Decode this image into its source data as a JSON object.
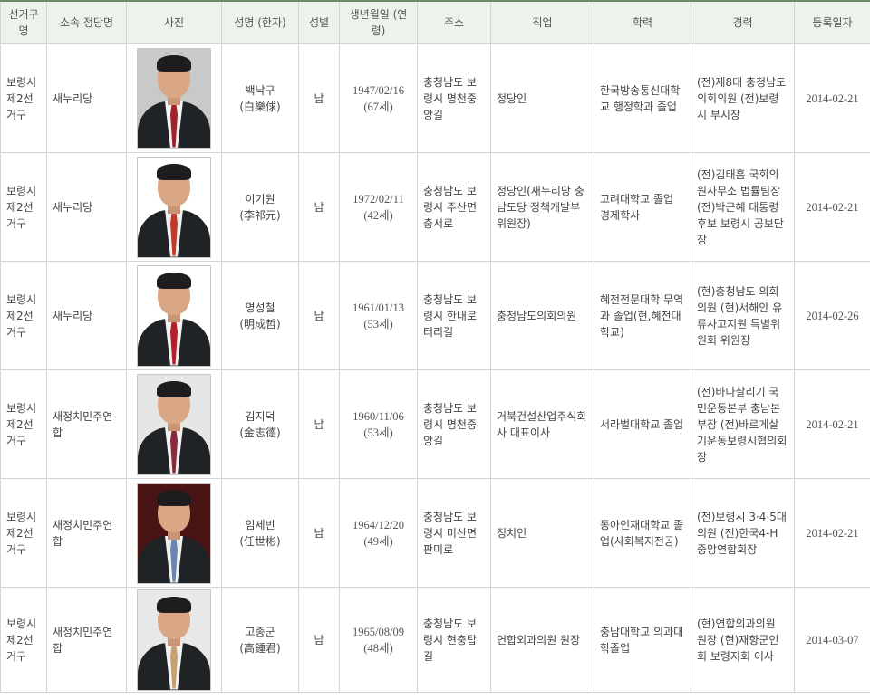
{
  "headers": {
    "district": "선거구명",
    "party": "소속 정당명",
    "photo": "사진",
    "name": "성명 (한자)",
    "sex": "성별",
    "birth": "생년월일 (연령)",
    "address": "주소",
    "job": "직업",
    "edu": "학력",
    "career": "경력",
    "reg": "등록일자"
  },
  "rows": [
    {
      "district": "보령시 제2선거구",
      "party": "새누리당",
      "name": "백낙구",
      "hanja": "(白樂俅)",
      "sex": "남",
      "birth": "1947/02/16",
      "age": "(67세)",
      "address": "충청남도 보령시 명천중앙길",
      "job": "정당인",
      "edu": "한국방송통신대학교 행정학과 졸업",
      "career": "(전)제8대 충청남도의회의원 (전)보령시 부시장",
      "reg": "2014-02-21",
      "photo": {
        "bg": "#c9c9c9",
        "tie": "#a3222a"
      }
    },
    {
      "district": "보령시 제2선거구",
      "party": "새누리당",
      "name": "이기원",
      "hanja": "(李祁元)",
      "sex": "남",
      "birth": "1972/02/11",
      "age": "(42세)",
      "address": "충청남도 보령시 주산면 충서로",
      "job": "정당인(새누리당 충남도당 정책개발부위원장)",
      "edu": "고려대학교 졸업 경제학사",
      "career": "(전)김태흠 국회의원사무소 법률팀장 (전)박근혜 대통령후보 보령시 공보단장",
      "reg": "2014-02-21",
      "photo": {
        "bg": "#ffffff",
        "tie": "#c0392b"
      }
    },
    {
      "district": "보령시 제2선거구",
      "party": "새누리당",
      "name": "명성철",
      "hanja": "(明成哲)",
      "sex": "남",
      "birth": "1961/01/13",
      "age": "(53세)",
      "address": "충청남도 보령시 한내로터리길",
      "job": "충청남도의회의원",
      "edu": "혜전전문대학 무역과 졸업(현,혜전대학교)",
      "career": "(현)충청남도 의회의원 (현)서해안 유류사고지원 특별위원회 위원장",
      "reg": "2014-02-26",
      "photo": {
        "bg": "#ffffff",
        "tie": "#b3202a"
      }
    },
    {
      "district": "보령시 제2선거구",
      "party": "새정치민주연합",
      "name": "김지덕",
      "hanja": "(金志德)",
      "sex": "남",
      "birth": "1960/11/06",
      "age": "(53세)",
      "address": "충청남도 보령시 명천중앙길",
      "job": "거북건설산업주식회사 대표이사",
      "edu": "서라벌대학교 졸업",
      "career": "(전)바다살리기 국민운동본부 충남본부장 (전)바르게살기운동보령시협의회장",
      "reg": "2014-02-21",
      "photo": {
        "bg": "#e6e6e6",
        "tie": "#8a2a3a"
      }
    },
    {
      "district": "보령시 제2선거구",
      "party": "새정치민주연합",
      "name": "임세빈",
      "hanja": "(任世彬)",
      "sex": "남",
      "birth": "1964/12/20",
      "age": "(49세)",
      "address": "충청남도 보령시 미산면 판미로",
      "job": "정치인",
      "edu": "동아인재대학교 졸업(사회복지전공)",
      "career": "(전)보령시 3·4·5대의원 (전)한국4-H 중앙연합회장",
      "reg": "2014-02-21",
      "photo": {
        "bg": "#4a1414",
        "tie": "#6a86b0"
      }
    },
    {
      "district": "보령시 제2선거구",
      "party": "새정치민주연합",
      "name": "고종군",
      "hanja": "(高鍾君)",
      "sex": "남",
      "birth": "1965/08/09",
      "age": "(48세)",
      "address": "충청남도 보령시 현충탑길",
      "job": "연합외과의원 원장",
      "edu": "충남대학교 의과대학졸업",
      "career": "(현)연합외과의원 원장 (현)재향군인회 보령지회 이사",
      "reg": "2014-03-07",
      "photo": {
        "bg": "#e8e8e8",
        "tie": "#c8a070"
      }
    }
  ]
}
